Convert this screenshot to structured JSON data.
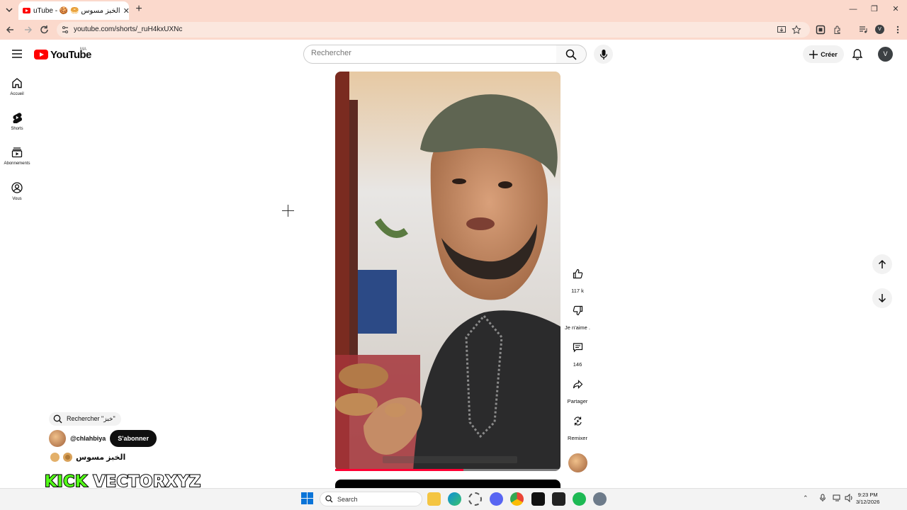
{
  "browser": {
    "tab_title": "الخبز مسوس - YouTube 🍪 🥯",
    "tab_display": "uTube - 🍪 🥯 الخبز مسوس",
    "url": "youtube.com/shorts/_ruH4kxUXNc",
    "profile_initial": "V",
    "icons": [
      "tab-list-icon",
      "back-icon",
      "forward-icon",
      "reload-icon",
      "site-info-icon",
      "install-icon",
      "star-icon",
      "screenshot-icon",
      "extensions-icon",
      "media-icon",
      "kebab-icon"
    ]
  },
  "header": {
    "logo_text": "YouTube",
    "country_code": "MA",
    "search_placeholder": "Rechercher",
    "create_label": "Créer",
    "avatar_initial": "V"
  },
  "sidebar": {
    "items": [
      {
        "label": "Accueil",
        "icon": "home-icon"
      },
      {
        "label": "Shorts",
        "icon": "shorts-icon"
      },
      {
        "label": "Abonnements",
        "icon": "subscriptions-icon"
      },
      {
        "label": "Vous",
        "icon": "you-icon"
      }
    ]
  },
  "short": {
    "progress": 0.57,
    "actions": {
      "like_count": "117 k",
      "dislike_label": "Je n'aime .",
      "comment_count": "146",
      "share_label": "Partager",
      "remix_label": "Remixer"
    },
    "search_chip": "Rechercher \"خبز\"",
    "channel_handle": "@chlahbiya",
    "subscribe_label": "S'abonner",
    "title": "الخبز مسوس"
  },
  "overlay": {
    "kick": "KICK",
    "name": "VECTORXYZ"
  },
  "taskbar": {
    "search_placeholder": "Search",
    "time": "9:23 PM",
    "date": "3/12/2026"
  },
  "colors": {
    "brand_red": "#ff0000",
    "tabstrip_bg": "#fbd9cc",
    "kick_green": "#53fc18",
    "progress_red": "#ff0033"
  }
}
